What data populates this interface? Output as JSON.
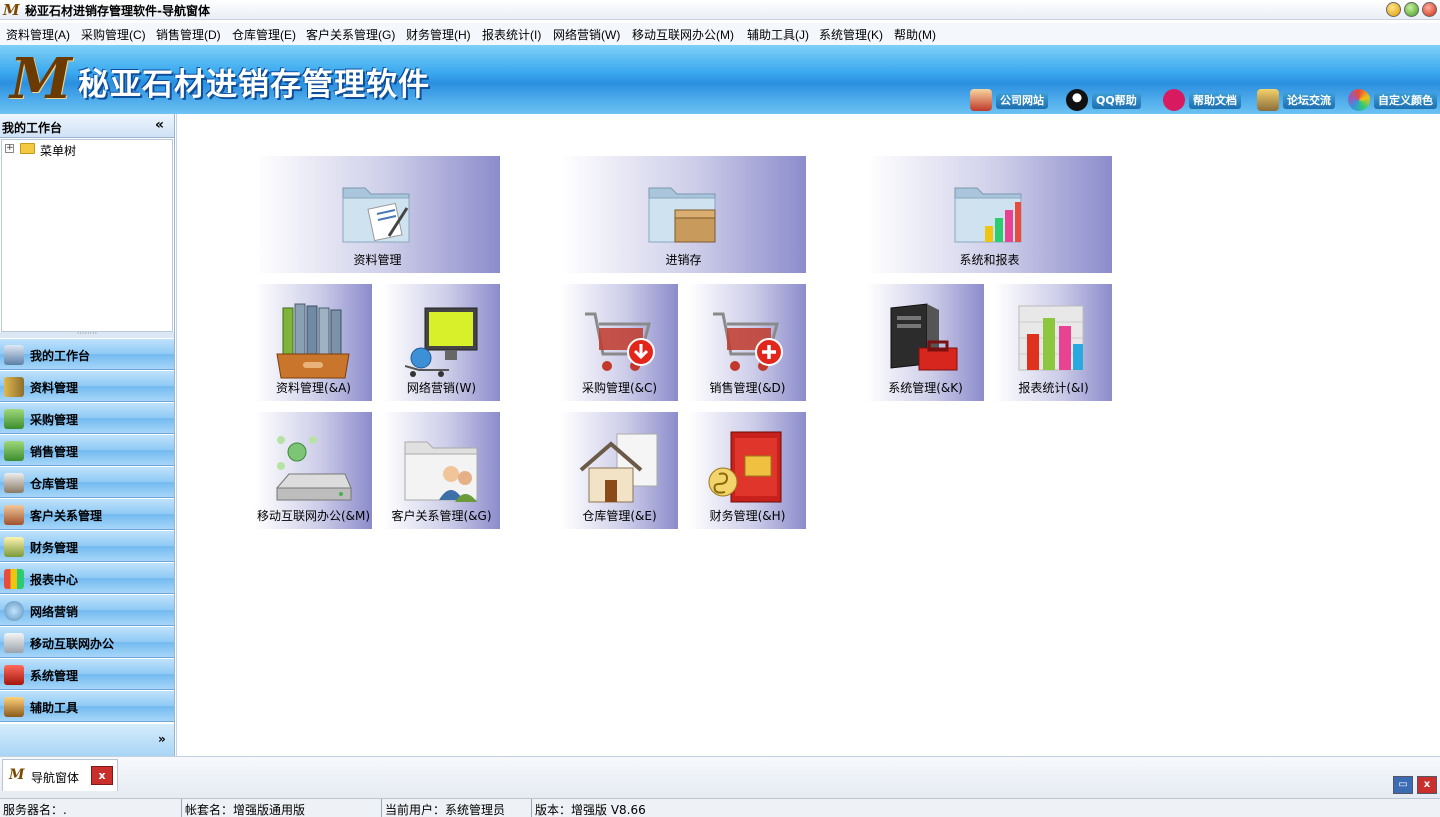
{
  "window": {
    "title": "秘亚石材进销存管理软件-导航窗体"
  },
  "menu": [
    "资料管理(A)",
    "采购管理(C)",
    "销售管理(D)",
    "仓库管理(E)",
    "客户关系管理(G)",
    "财务管理(H)",
    "报表统计(I)",
    "网络营销(W)",
    "移动互联网办公(M)",
    "辅助工具(J)",
    "系统管理(K)",
    "帮助(M)"
  ],
  "banner": {
    "title": "秘亚石材进销存管理软件",
    "links": [
      "公司网站",
      "QQ帮助",
      "帮助文档",
      "论坛交流",
      "自定义颜色"
    ]
  },
  "left_panel": {
    "header": "我的工作台",
    "collapse": "«",
    "tree_root": "菜单树",
    "splitter": "········",
    "nav": [
      "我的工作台",
      "资料管理",
      "采购管理",
      "销售管理",
      "仓库管理",
      "客户关系管理",
      "财务管理",
      "报表中心",
      "网络营销",
      "移动互联网办公",
      "系统管理",
      "辅助工具"
    ],
    "more": "»"
  },
  "tiles": {
    "big": [
      "资料管理",
      "进销存",
      "系统和报表"
    ],
    "small": [
      "资料管理(&A)",
      "网络营销(W)",
      "采购管理(&C)",
      "销售管理(&D)",
      "系统管理(&K)",
      "报表统计(&I)",
      "移动互联网办公(&M)",
      "客户关系管理(&G)",
      "仓库管理(&E)",
      "财务管理(&H)"
    ]
  },
  "tabs": {
    "active": "导航窗体",
    "close": "x",
    "restore": "▭",
    "close_all": "x"
  },
  "status": {
    "server": "服务器名：.",
    "account": "帐套名：增强版通用版",
    "user": "当前用户：系统管理员",
    "version": "版本：增强版 V8.66"
  }
}
